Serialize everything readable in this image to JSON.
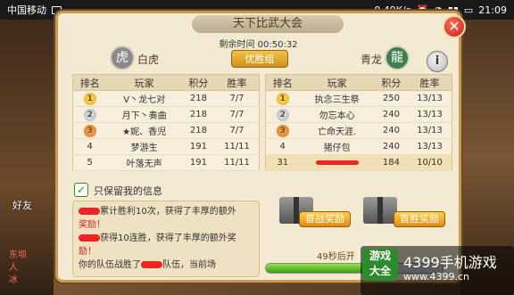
{
  "status_bar": {
    "carrier": "中国移动",
    "speed": "0.49K/s",
    "time": "21:09",
    "icons": [
      "image-icon",
      "alarm-icon",
      "wifi-icon",
      "signal-icon",
      "battery-icon"
    ]
  },
  "side": {
    "friend": "好友",
    "chat": [
      "东坝",
      "人",
      "冰"
    ]
  },
  "panel": {
    "title": "天下比武大会",
    "close": "✕",
    "remaining_time": "剩余时间 00:50:32",
    "team_left": "白虎",
    "group_tab": "优胜组",
    "team_right": "青龙",
    "info": "i"
  },
  "table_headers": [
    "排名",
    "玩家",
    "积分",
    "胜率"
  ],
  "left_table": [
    {
      "rank": "1",
      "player": "V丶龙七对",
      "score": "218",
      "rate": "7/7",
      "color": "c-red",
      "badge": "rb1"
    },
    {
      "rank": "2",
      "player": "月下丶奏曲",
      "score": "218",
      "rate": "7/7",
      "color": "c-blue",
      "badge": "rb2"
    },
    {
      "rank": "3",
      "player": "★妮、香児",
      "score": "218",
      "rate": "7/7",
      "color": "c-green",
      "badge": "rb3"
    },
    {
      "rank": "4",
      "player": "梦游生",
      "score": "191",
      "rate": "11/11",
      "color": "",
      "badge": ""
    },
    {
      "rank": "5",
      "player": "叶落无声",
      "score": "191",
      "rate": "11/11",
      "color": "",
      "badge": ""
    }
  ],
  "right_table": [
    {
      "rank": "1",
      "player": "执念三生祭",
      "score": "250",
      "rate": "13/13",
      "color": "c-red",
      "badge": "rb1"
    },
    {
      "rank": "2",
      "player": "勿忘本心",
      "score": "240",
      "rate": "13/13",
      "color": "c-blue",
      "badge": "rb2"
    },
    {
      "rank": "3",
      "player": "亡命天涯.",
      "score": "240",
      "rate": "13/13",
      "color": "c-green",
      "badge": "rb3"
    },
    {
      "rank": "4",
      "player": "猪仔包",
      "score": "240",
      "rate": "13/13",
      "color": "",
      "badge": ""
    }
  ],
  "my_row": {
    "rank": "31",
    "score": "184",
    "rate": "10/10"
  },
  "notice": {
    "label": "只保留我的信息",
    "messages": [
      {
        "pre": "",
        "text": "累计胜利10次，获得了丰厚的额外"
      },
      {
        "pre": "",
        "text": "奖励！"
      },
      {
        "pre": "",
        "text": "获得10连胜，获得了丰厚的额外奖"
      },
      {
        "pre": "",
        "text": "励！"
      },
      {
        "pre": "你的队伍战胜了",
        "text": "队伍，当前场"
      }
    ]
  },
  "rewards": {
    "first_win": "首战奖励",
    "first_victory": "首胜奖励",
    "timer": "49秒后开",
    "progress": 0.72
  },
  "watermark": {
    "box_line1": "游戏",
    "box_line2": "大全",
    "title": "4399手机游戏",
    "url": "www.4399.cn"
  }
}
